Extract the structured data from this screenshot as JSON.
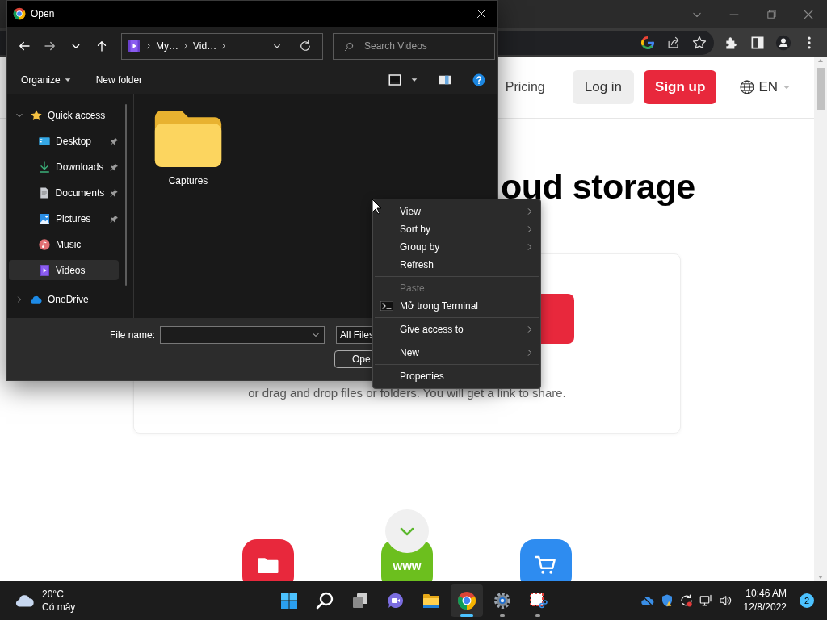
{
  "page": {
    "nav": {
      "link": "Pricing",
      "login": "Log in",
      "signup": "Sign up",
      "language": "EN"
    },
    "heading": "oud storage",
    "drop_hint": "or drag and drop files or folders. You will get a link to share.",
    "apps": [
      {
        "kind": "folder"
      },
      {
        "kind": "web",
        "label": "www"
      },
      {
        "kind": "cart"
      }
    ]
  },
  "dialog": {
    "title": "Open",
    "breadcrumb": [
      "My…",
      "Vid…"
    ],
    "search": {
      "placeholder": "Search Videos"
    },
    "commands": [
      {
        "label": "Organize",
        "menu": true
      },
      {
        "label": "New folder",
        "menu": false
      }
    ],
    "sidebar": [
      {
        "label": "Quick access",
        "expanded": true,
        "selected": false,
        "children": [
          {
            "label": "Desktop",
            "pinned": true,
            "selected": false
          },
          {
            "label": "Downloads",
            "pinned": true,
            "selected": false
          },
          {
            "label": "Documents",
            "pinned": true,
            "selected": false
          },
          {
            "label": "Pictures",
            "pinned": true,
            "selected": false
          },
          {
            "label": "Music",
            "pinned": false,
            "selected": false
          },
          {
            "label": "Videos",
            "pinned": false,
            "selected": true
          }
        ]
      },
      {
        "label": "OneDrive",
        "expanded": false,
        "selected": false
      }
    ],
    "items": [
      {
        "name": "Captures"
      }
    ],
    "file_name": {
      "label": "File name:"
    },
    "file_type": "All Files",
    "open_button": "Ope"
  },
  "context_menu": {
    "items": [
      {
        "kind": "item",
        "label": "View",
        "submenu": true,
        "disabled": false
      },
      {
        "kind": "item",
        "label": "Sort by",
        "submenu": true,
        "disabled": false
      },
      {
        "kind": "item",
        "label": "Group by",
        "submenu": true,
        "disabled": false
      },
      {
        "kind": "item",
        "label": "Refresh",
        "submenu": false,
        "disabled": false
      },
      {
        "kind": "separator"
      },
      {
        "kind": "item",
        "label": "Paste",
        "submenu": false,
        "disabled": true
      },
      {
        "kind": "terminal",
        "label": "Mở trong Terminal",
        "submenu": false,
        "disabled": false
      },
      {
        "kind": "separator"
      },
      {
        "kind": "item",
        "label": "Give access to",
        "submenu": true,
        "disabled": false
      },
      {
        "kind": "separator"
      },
      {
        "kind": "item",
        "label": "New",
        "submenu": true,
        "disabled": false
      },
      {
        "kind": "separator"
      },
      {
        "kind": "item",
        "label": "Properties",
        "submenu": false,
        "disabled": false
      }
    ]
  },
  "taskbar": {
    "weather": {
      "temperature": "20°C",
      "condition": "Có mây"
    },
    "apps": [
      {
        "kind": "start",
        "running": false,
        "selected": false
      },
      {
        "kind": "search",
        "running": false,
        "selected": false
      },
      {
        "kind": "taskview",
        "running": false,
        "selected": false
      },
      {
        "kind": "chat",
        "running": false,
        "selected": false
      },
      {
        "kind": "explorer",
        "running": false,
        "selected": false
      },
      {
        "kind": "chrome",
        "running": true,
        "selected": true
      },
      {
        "kind": "settings",
        "running": true,
        "selected": false
      },
      {
        "kind": "snip",
        "running": true,
        "selected": false
      }
    ],
    "clock": {
      "time": "10:46 AM",
      "date": "12/8/2022"
    },
    "notifications": "2"
  }
}
